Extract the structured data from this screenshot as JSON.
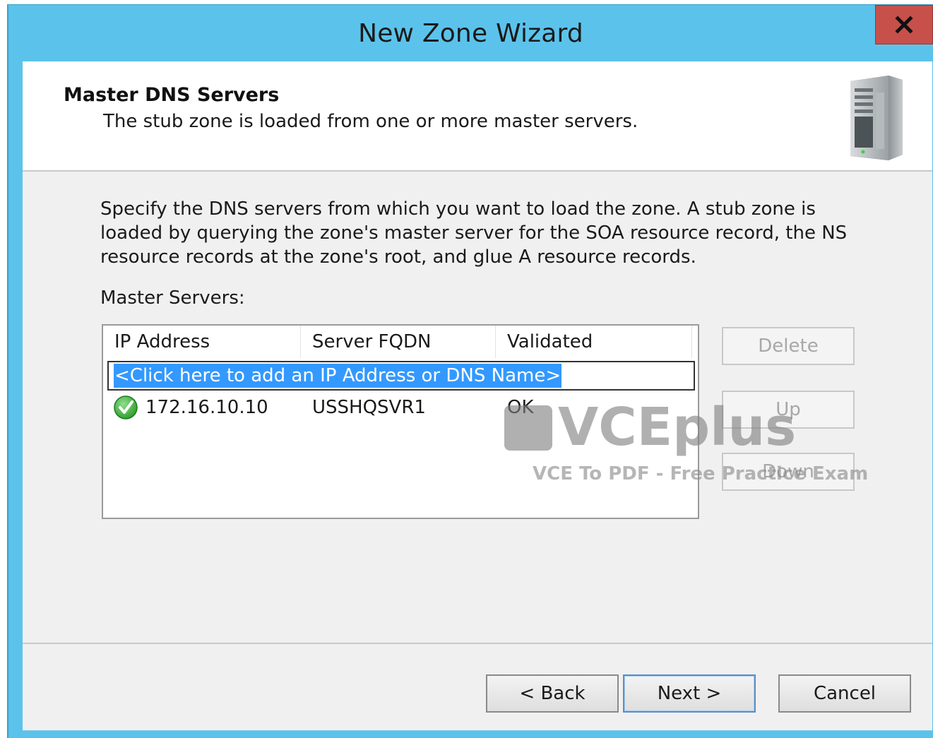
{
  "window": {
    "title": "New Zone Wizard",
    "close_label": "x"
  },
  "header": {
    "title": "Master DNS Servers",
    "subtitle": "The stub zone is loaded from one or more master servers."
  },
  "body": {
    "description": "Specify the DNS servers from which you want to load the zone. A stub zone is loaded by querying the zone's master server for the SOA resource record, the NS resource records at the zone's root, and glue A resource records.",
    "master_servers_label": "Master Servers:"
  },
  "list": {
    "columns": [
      "IP Address",
      "Server FQDN",
      "Validated"
    ],
    "add_placeholder": "<Click here to add an IP Address or DNS Name>",
    "rows": [
      {
        "ip": "172.16.10.10",
        "fqdn": "USSHQSVR1",
        "validated": "OK",
        "status_icon": "green-check-icon"
      }
    ]
  },
  "side_buttons": {
    "delete": "Delete",
    "up": "Up",
    "down": "Down"
  },
  "footer": {
    "back": "< Back",
    "next": "Next >",
    "cancel": "Cancel"
  },
  "watermark": {
    "logo": "VCEplus",
    "tagline": "VCE To PDF - Free Practice Exam"
  },
  "colors": {
    "titlebar": "#5bc3eb",
    "close_button": "#c7504a",
    "selection": "#3399ff",
    "dialog_background": "#f0f0f0"
  }
}
